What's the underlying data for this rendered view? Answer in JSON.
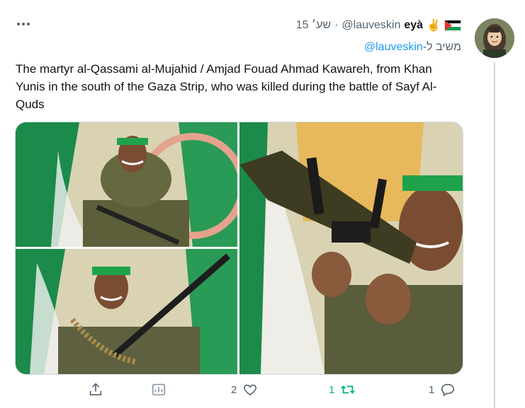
{
  "tweet": {
    "display_name": "eyà",
    "name_emoji": "✌",
    "handle": "@lauveskin",
    "separator": "·",
    "time": "15 שע׳",
    "reply_prefix": "משיב ל-",
    "reply_handle": "@lauveskin",
    "text": "The martyr al-Qassami al-Mujahid / Amjad Fouad Ahmad Kawareh, from Khan Yunis in the south of the Gaza Strip, who was killed during the battle of Sayf Al-Quds",
    "more_icon": "more-dots-icon"
  },
  "actions": {
    "share_icon": "share-icon",
    "analytics_icon": "analytics-icon",
    "likes": "2",
    "like_icon": "heart-icon",
    "retweets": "1",
    "retweet_icon": "retweet-icon",
    "replies": "1",
    "reply_icon": "reply-bubble-icon"
  },
  "colors": {
    "accent": "#1d9bf0",
    "retweet_green": "#00ba7c",
    "muted": "#536471",
    "headband_green": "#1fa34a"
  }
}
